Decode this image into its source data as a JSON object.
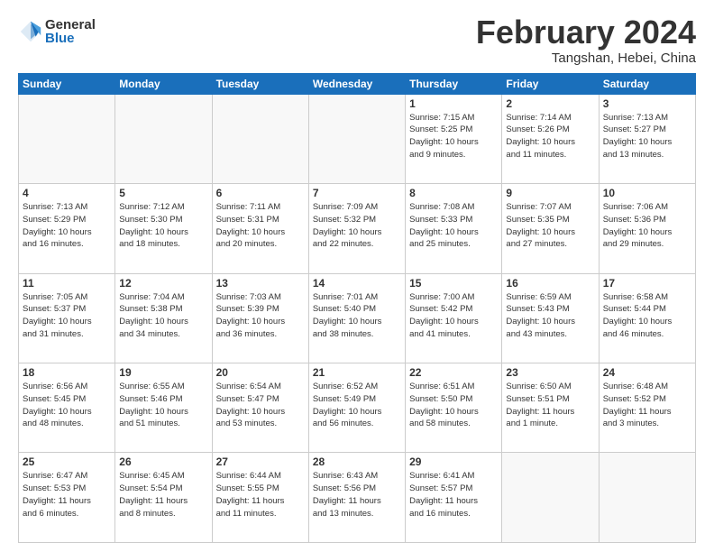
{
  "logo": {
    "general": "General",
    "blue": "Blue"
  },
  "title": "February 2024",
  "subtitle": "Tangshan, Hebei, China",
  "days_of_week": [
    "Sunday",
    "Monday",
    "Tuesday",
    "Wednesday",
    "Thursday",
    "Friday",
    "Saturday"
  ],
  "weeks": [
    {
      "days": [
        {
          "num": "",
          "info": "",
          "empty": true
        },
        {
          "num": "",
          "info": "",
          "empty": true
        },
        {
          "num": "",
          "info": "",
          "empty": true
        },
        {
          "num": "",
          "info": "",
          "empty": true
        },
        {
          "num": "1",
          "info": "Sunrise: 7:15 AM\nSunset: 5:25 PM\nDaylight: 10 hours\nand 9 minutes.",
          "empty": false
        },
        {
          "num": "2",
          "info": "Sunrise: 7:14 AM\nSunset: 5:26 PM\nDaylight: 10 hours\nand 11 minutes.",
          "empty": false
        },
        {
          "num": "3",
          "info": "Sunrise: 7:13 AM\nSunset: 5:27 PM\nDaylight: 10 hours\nand 13 minutes.",
          "empty": false
        }
      ]
    },
    {
      "days": [
        {
          "num": "4",
          "info": "Sunrise: 7:13 AM\nSunset: 5:29 PM\nDaylight: 10 hours\nand 16 minutes.",
          "empty": false
        },
        {
          "num": "5",
          "info": "Sunrise: 7:12 AM\nSunset: 5:30 PM\nDaylight: 10 hours\nand 18 minutes.",
          "empty": false
        },
        {
          "num": "6",
          "info": "Sunrise: 7:11 AM\nSunset: 5:31 PM\nDaylight: 10 hours\nand 20 minutes.",
          "empty": false
        },
        {
          "num": "7",
          "info": "Sunrise: 7:09 AM\nSunset: 5:32 PM\nDaylight: 10 hours\nand 22 minutes.",
          "empty": false
        },
        {
          "num": "8",
          "info": "Sunrise: 7:08 AM\nSunset: 5:33 PM\nDaylight: 10 hours\nand 25 minutes.",
          "empty": false
        },
        {
          "num": "9",
          "info": "Sunrise: 7:07 AM\nSunset: 5:35 PM\nDaylight: 10 hours\nand 27 minutes.",
          "empty": false
        },
        {
          "num": "10",
          "info": "Sunrise: 7:06 AM\nSunset: 5:36 PM\nDaylight: 10 hours\nand 29 minutes.",
          "empty": false
        }
      ]
    },
    {
      "days": [
        {
          "num": "11",
          "info": "Sunrise: 7:05 AM\nSunset: 5:37 PM\nDaylight: 10 hours\nand 31 minutes.",
          "empty": false
        },
        {
          "num": "12",
          "info": "Sunrise: 7:04 AM\nSunset: 5:38 PM\nDaylight: 10 hours\nand 34 minutes.",
          "empty": false
        },
        {
          "num": "13",
          "info": "Sunrise: 7:03 AM\nSunset: 5:39 PM\nDaylight: 10 hours\nand 36 minutes.",
          "empty": false
        },
        {
          "num": "14",
          "info": "Sunrise: 7:01 AM\nSunset: 5:40 PM\nDaylight: 10 hours\nand 38 minutes.",
          "empty": false
        },
        {
          "num": "15",
          "info": "Sunrise: 7:00 AM\nSunset: 5:42 PM\nDaylight: 10 hours\nand 41 minutes.",
          "empty": false
        },
        {
          "num": "16",
          "info": "Sunrise: 6:59 AM\nSunset: 5:43 PM\nDaylight: 10 hours\nand 43 minutes.",
          "empty": false
        },
        {
          "num": "17",
          "info": "Sunrise: 6:58 AM\nSunset: 5:44 PM\nDaylight: 10 hours\nand 46 minutes.",
          "empty": false
        }
      ]
    },
    {
      "days": [
        {
          "num": "18",
          "info": "Sunrise: 6:56 AM\nSunset: 5:45 PM\nDaylight: 10 hours\nand 48 minutes.",
          "empty": false
        },
        {
          "num": "19",
          "info": "Sunrise: 6:55 AM\nSunset: 5:46 PM\nDaylight: 10 hours\nand 51 minutes.",
          "empty": false
        },
        {
          "num": "20",
          "info": "Sunrise: 6:54 AM\nSunset: 5:47 PM\nDaylight: 10 hours\nand 53 minutes.",
          "empty": false
        },
        {
          "num": "21",
          "info": "Sunrise: 6:52 AM\nSunset: 5:49 PM\nDaylight: 10 hours\nand 56 minutes.",
          "empty": false
        },
        {
          "num": "22",
          "info": "Sunrise: 6:51 AM\nSunset: 5:50 PM\nDaylight: 10 hours\nand 58 minutes.",
          "empty": false
        },
        {
          "num": "23",
          "info": "Sunrise: 6:50 AM\nSunset: 5:51 PM\nDaylight: 11 hours\nand 1 minute.",
          "empty": false
        },
        {
          "num": "24",
          "info": "Sunrise: 6:48 AM\nSunset: 5:52 PM\nDaylight: 11 hours\nand 3 minutes.",
          "empty": false
        }
      ]
    },
    {
      "days": [
        {
          "num": "25",
          "info": "Sunrise: 6:47 AM\nSunset: 5:53 PM\nDaylight: 11 hours\nand 6 minutes.",
          "empty": false
        },
        {
          "num": "26",
          "info": "Sunrise: 6:45 AM\nSunset: 5:54 PM\nDaylight: 11 hours\nand 8 minutes.",
          "empty": false
        },
        {
          "num": "27",
          "info": "Sunrise: 6:44 AM\nSunset: 5:55 PM\nDaylight: 11 hours\nand 11 minutes.",
          "empty": false
        },
        {
          "num": "28",
          "info": "Sunrise: 6:43 AM\nSunset: 5:56 PM\nDaylight: 11 hours\nand 13 minutes.",
          "empty": false
        },
        {
          "num": "29",
          "info": "Sunrise: 6:41 AM\nSunset: 5:57 PM\nDaylight: 11 hours\nand 16 minutes.",
          "empty": false
        },
        {
          "num": "",
          "info": "",
          "empty": true
        },
        {
          "num": "",
          "info": "",
          "empty": true
        }
      ]
    }
  ]
}
